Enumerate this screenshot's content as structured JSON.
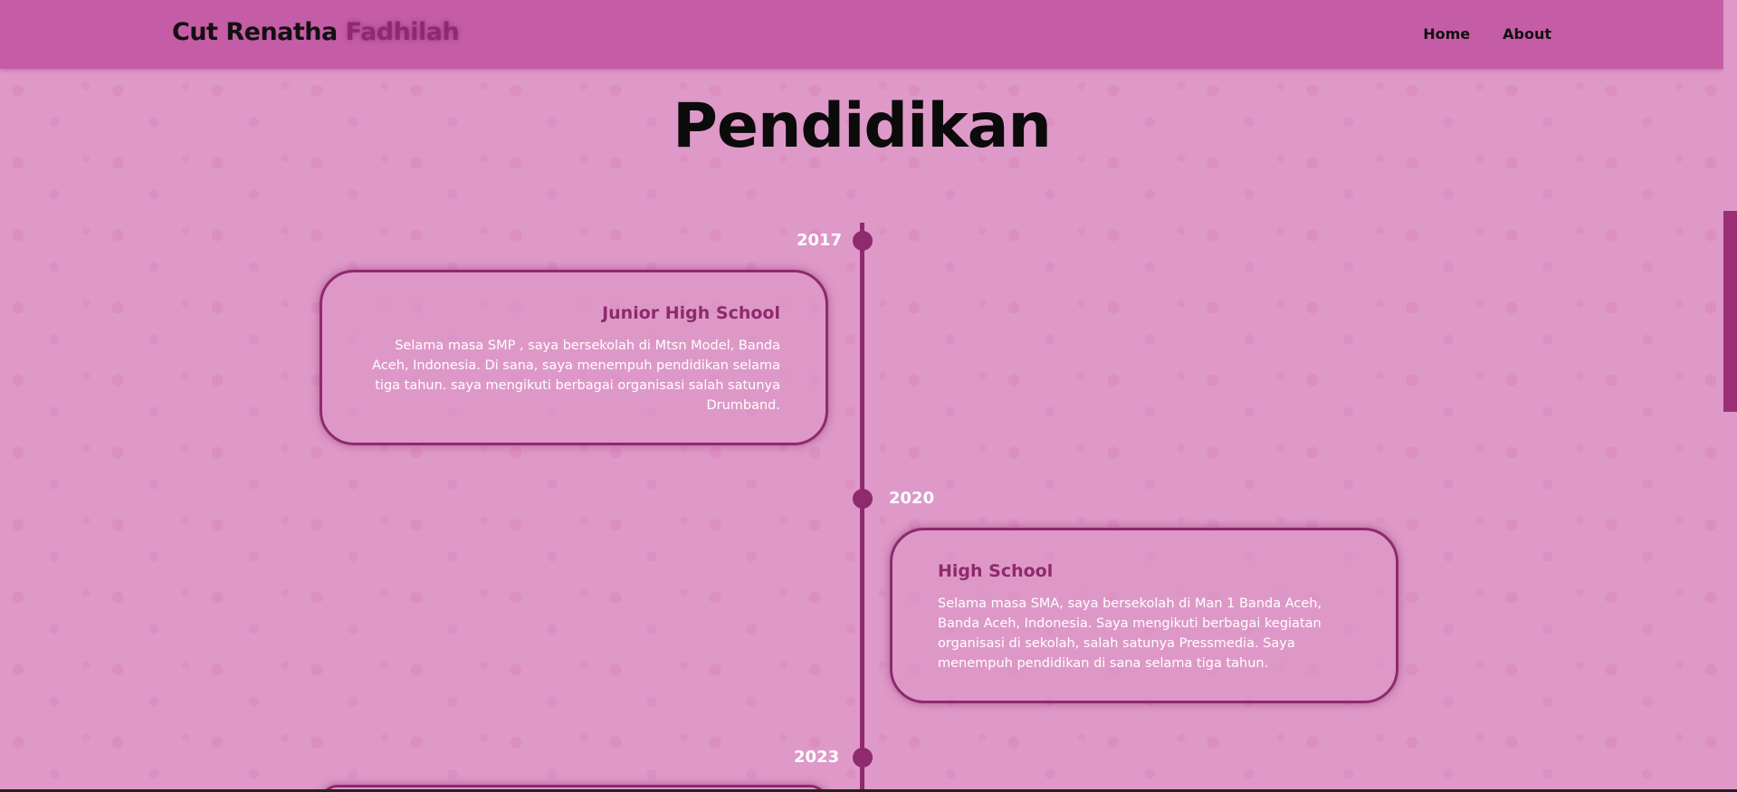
{
  "header": {
    "brand_first": "Cut Renatha",
    "brand_second": "Fadhilah",
    "nav": [
      {
        "label": "Home"
      },
      {
        "label": "About"
      }
    ]
  },
  "main": {
    "title": "Pendidikan",
    "timeline": [
      {
        "year": "2017",
        "title": "Junior High School",
        "text": "Selama masa SMP , saya bersekolah di Mtsn Model, Banda Aceh, Indonesia. Di sana, saya menempuh pendidikan selama tiga tahun. saya mengikuti berbagai organisasi salah satunya Drumband."
      },
      {
        "year": "2020",
        "title": "High School",
        "text": "Selama masa SMA, saya bersekolah di Man 1 Banda Aceh, Banda Aceh, Indonesia. Saya mengikuti berbagai kegiatan organisasi di sekolah, salah satunya Pressmedia. Saya menempuh pendidikan di sana selama tiga tahun."
      },
      {
        "year": "2023"
      }
    ]
  },
  "colors": {
    "navbar": "#c55ca6",
    "background": "#de99c8",
    "accent": "#8e2a6d",
    "text_dark": "#111111",
    "text_light": "#ffffff"
  }
}
